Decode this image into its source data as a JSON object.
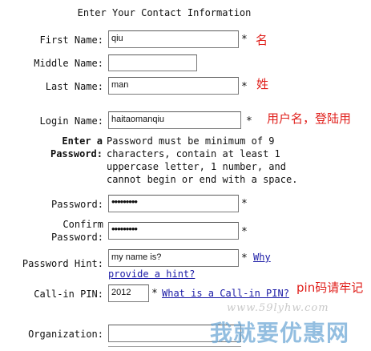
{
  "form": {
    "title": "Enter Your Contact Information",
    "first_name": {
      "label": "First Name:",
      "value": "qiu",
      "required": "*",
      "note": "名"
    },
    "middle_name": {
      "label": "Middle Name:",
      "value": ""
    },
    "last_name": {
      "label": "Last Name:",
      "value": "man",
      "required": "*",
      "note": "姓"
    },
    "login_name": {
      "label": "Login Name:",
      "value": "haitaomanqiu",
      "required": "*",
      "note": "用户名，登陆用"
    },
    "enter_password": {
      "label_line1": "Enter a",
      "label_line2": "Password:",
      "desc_lines": [
        "Password must be minimum of 9",
        "characters, contain at least 1",
        "uppercase letter, 1 number, and",
        "cannot begin or end with a space."
      ]
    },
    "password": {
      "label": "Password:",
      "value": "•••••••••",
      "required": "*"
    },
    "confirm_password": {
      "label_line1": "Confirm",
      "label_line2": "Password:",
      "value": "•••••••••",
      "required": "*"
    },
    "password_hint": {
      "label": "Password Hint:",
      "value": "my name is?",
      "required": "*",
      "link_line1": "Why",
      "link_line2": "provide a hint?"
    },
    "callin_pin": {
      "label": "Call-in PIN:",
      "value": "2012",
      "required": "*",
      "link": "What is a Call-in PIN?",
      "note": "pin码请牢记"
    },
    "organization": {
      "label": "Organization:",
      "value": ""
    }
  },
  "watermark": {
    "url": "www.59lyhw.com",
    "text": "我就要优惠网"
  }
}
